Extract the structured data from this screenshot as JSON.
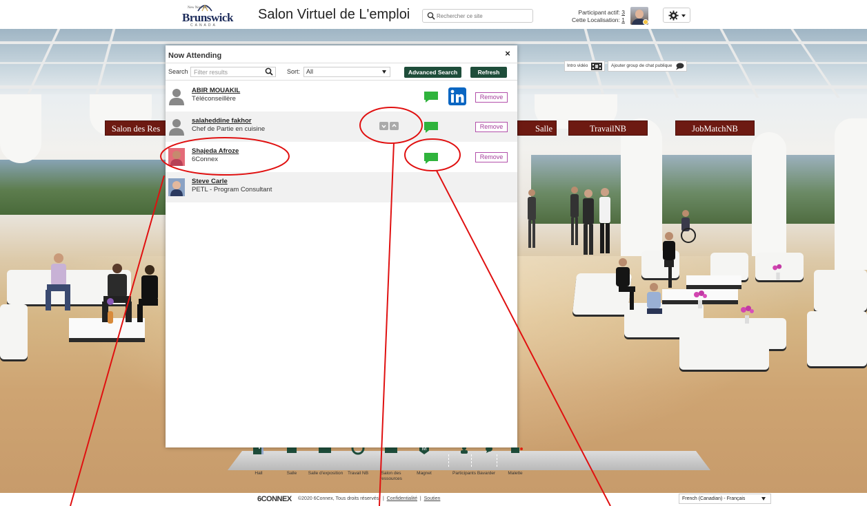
{
  "header": {
    "logo_small": "New Nouveau",
    "logo_word": "Brunswick",
    "logo_country": "CANADA",
    "site_title": "Salon Virtuel de L'emploi",
    "search_placeholder": "Rechercher ce site",
    "stats": {
      "active_label": "Participant actif:",
      "active_count": "3",
      "location_label": "Cette Localisation:",
      "location_count": "1"
    }
  },
  "scene": {
    "banners": [
      "Salon des Res",
      "Salle",
      "TravailNB",
      "JobMatchNB"
    ],
    "intro_label": "Intro vidéo",
    "chat_group_label": "Ajouter group de chat publique"
  },
  "modal": {
    "title": "Now Attending",
    "close_glyph": "×",
    "search_label": "Search",
    "search_placeholder": "Filter results",
    "sort_label": "Sort:",
    "sort_value": "All",
    "advanced_search": "Advanced Search",
    "refresh": "Refresh",
    "remove_label": "Remove",
    "attendees": [
      {
        "name": "ABIR MOUAKIL",
        "title": "Téléconseillère",
        "avatar": "person-silhouette-icon"
      },
      {
        "name": "salaheddine fakhor",
        "title": "Chef de Partie en cuisine",
        "avatar": "person-silhouette-icon"
      },
      {
        "name": "Shajeda Afroze",
        "title": "6Connex",
        "avatar": "photo"
      },
      {
        "name": "Steve Carle",
        "title": "PETL - Program Consultant",
        "avatar": "photo"
      }
    ]
  },
  "dock": {
    "items": [
      "Hall",
      "Salle",
      "Salle d'exposition",
      "Travail NB",
      "Salon des ressources",
      "Magnet",
      "Participants",
      "Bavarder",
      "Malette"
    ]
  },
  "footer": {
    "brand": "6CONNEX",
    "copyright": "©2020 6Connex, Tous droits réservés.",
    "sep": "|",
    "privacy": "Confidentialité",
    "support": "Soutien",
    "language": "French (Canadian) - Français"
  },
  "colors": {
    "banner": "#6d1a12",
    "button_green": "#1e4d3a",
    "chat_green": "#2fb33c",
    "remove_purple": "#a33c9a",
    "linkedin": "#0a66c2",
    "annotation_red": "#e01010"
  }
}
